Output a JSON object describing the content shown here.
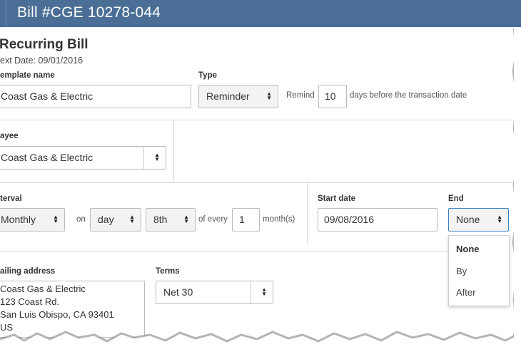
{
  "header": {
    "title": "Bill #CGE 10278-044"
  },
  "form": {
    "heading": "Recurring Bill",
    "next_date": "ext Date: 09/01/2016",
    "template_name_label": "emplate name",
    "template_name_value": "Coast Gas & Electric",
    "type_label": "Type",
    "type_value": "Reminder",
    "remind_label": "Remind",
    "remind_days": "10",
    "remind_suffix": "days before the transaction date",
    "payee_label": "ayee",
    "payee_value": "Coast Gas & Electric",
    "interval_label": "terval",
    "interval_value": "Monthly",
    "on_label": "on",
    "day_value": "day",
    "nth_value": "8th",
    "of_every_label": "of every",
    "every_count": "1",
    "months_label": "month(s)",
    "start_date_label": "Start date",
    "start_date_value": "09/08/2016",
    "end_label": "End",
    "end_value": "None",
    "end_options": [
      "None",
      "By",
      "After"
    ],
    "mailing_label": "ailing address",
    "mailing_lines": [
      "Coast Gas & Electric",
      "123 Coast Rd.",
      "San Luis Obispo, CA  93401",
      "US"
    ],
    "terms_label": "Terms",
    "terms_value": "Net 30"
  },
  "icons": {
    "select_arrow": "up-down-caret-icon"
  }
}
